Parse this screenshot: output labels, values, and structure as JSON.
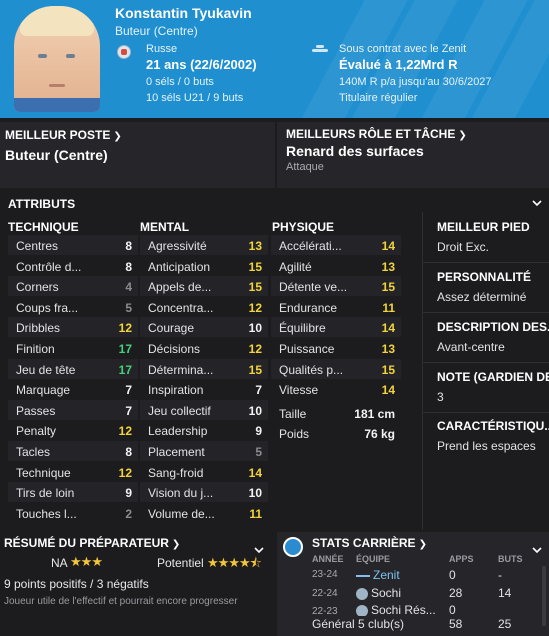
{
  "player": {
    "name": "Konstantin Tyukavin",
    "position": "Buteur (Centre)",
    "nationality": "Russe",
    "age": "21 ans (22/6/2002)",
    "caps": "0 séls / 0 buts",
    "u21": "10 séls U21 / 9 buts",
    "contract": "Sous contrat avec le Zenit",
    "value": "Évalué à 1,22Mrd R",
    "wage": "140M R p/a jusqu'au 30/6/2027",
    "status": "Titulaire régulier"
  },
  "best_position": {
    "label": "MEILLEUR POSTE",
    "value": "Buteur (Centre)"
  },
  "best_role": {
    "label": "MEILLEURS RÔLE ET TÂCHE",
    "value": "Renard des surfaces",
    "duty": "Attaque"
  },
  "attributes": {
    "title": "ATTRIBUTS",
    "technical": {
      "title": "TECHNIQUE",
      "rows": [
        {
          "label": "Centres",
          "value": "8"
        },
        {
          "label": "Contrôle d...",
          "value": "8"
        },
        {
          "label": "Corners",
          "value": "4"
        },
        {
          "label": "Coups fra...",
          "value": "5"
        },
        {
          "label": "Dribbles",
          "value": "12"
        },
        {
          "label": "Finition",
          "value": "17"
        },
        {
          "label": "Jeu de tête",
          "value": "17"
        },
        {
          "label": "Marquage",
          "value": "7"
        },
        {
          "label": "Passes",
          "value": "7"
        },
        {
          "label": "Penalty",
          "value": "12"
        },
        {
          "label": "Tacles",
          "value": "8"
        },
        {
          "label": "Technique",
          "value": "12"
        },
        {
          "label": "Tirs de loin",
          "value": "9"
        },
        {
          "label": "Touches l...",
          "value": "2"
        }
      ]
    },
    "mental": {
      "title": "MENTAL",
      "rows": [
        {
          "label": "Agressivité",
          "value": "13"
        },
        {
          "label": "Anticipation",
          "value": "15"
        },
        {
          "label": "Appels de...",
          "value": "15"
        },
        {
          "label": "Concentra...",
          "value": "12"
        },
        {
          "label": "Courage",
          "value": "10"
        },
        {
          "label": "Décisions",
          "value": "12"
        },
        {
          "label": "Détermina...",
          "value": "15"
        },
        {
          "label": "Inspiration",
          "value": "7"
        },
        {
          "label": "Jeu collectif",
          "value": "10"
        },
        {
          "label": "Leadership",
          "value": "9"
        },
        {
          "label": "Placement",
          "value": "5"
        },
        {
          "label": "Sang-froid",
          "value": "14"
        },
        {
          "label": "Vision du j...",
          "value": "10"
        },
        {
          "label": "Volume de...",
          "value": "11"
        }
      ]
    },
    "physical": {
      "title": "PHYSIQUE",
      "rows": [
        {
          "label": "Accélérati...",
          "value": "14"
        },
        {
          "label": "Agilité",
          "value": "13"
        },
        {
          "label": "Détente ve...",
          "value": "15"
        },
        {
          "label": "Endurance",
          "value": "11"
        },
        {
          "label": "Équilibre",
          "value": "14"
        },
        {
          "label": "Puissance",
          "value": "13"
        },
        {
          "label": "Qualités p...",
          "value": "15"
        },
        {
          "label": "Vitesse",
          "value": "14"
        }
      ],
      "height_label": "Taille",
      "height": "181 cm",
      "weight_label": "Poids",
      "weight": "76 kg"
    }
  },
  "side": {
    "foot_label": "MEILLEUR PIED",
    "foot": "Droit Exc.",
    "personality_label": "PERSONNALITÉ",
    "personality": "Assez déterminé",
    "description_label": "DESCRIPTION DES...",
    "description": "Avant-centre",
    "gk_label": "NOTE (GARDIEN DE...",
    "gk": "3",
    "traits_label": "CARACTÉRISTIQU...",
    "traits": "Prend les espaces"
  },
  "coach": {
    "title": "RÉSUMÉ DU PRÉPARATEUR",
    "current_label": "NA",
    "current_stars": 3,
    "potential_label": "Potentiel",
    "potential_stars": 4.5,
    "summary": "9 points positifs / 3 négatifs",
    "note": "Joueur utile de l'effectif et pourrait encore progresser"
  },
  "career": {
    "title": "STATS CARRIÈRE",
    "headers": {
      "year": "ANNÉE",
      "team": "ÉQUIPE",
      "apps": "APPS",
      "goals": "BUTS"
    },
    "rows": [
      {
        "year": "23-24",
        "team": "Zenit",
        "apps": "0",
        "goals": "-"
      },
      {
        "year": "22-24",
        "team": "Sochi",
        "apps": "28",
        "goals": "14"
      },
      {
        "year": "22-23",
        "team": "Sochi Rés...",
        "apps": "0",
        "goals": "-"
      }
    ],
    "total_label": "Général 5 club(s)",
    "total_apps": "58",
    "total_goals": "25"
  },
  "colors": {
    "header": "#1f8fd0",
    "attr_white": "#f3f3f3",
    "attr_yellow": "#f2d43a",
    "attr_green": "#43d17a",
    "attr_grey": "#8b8b90"
  }
}
